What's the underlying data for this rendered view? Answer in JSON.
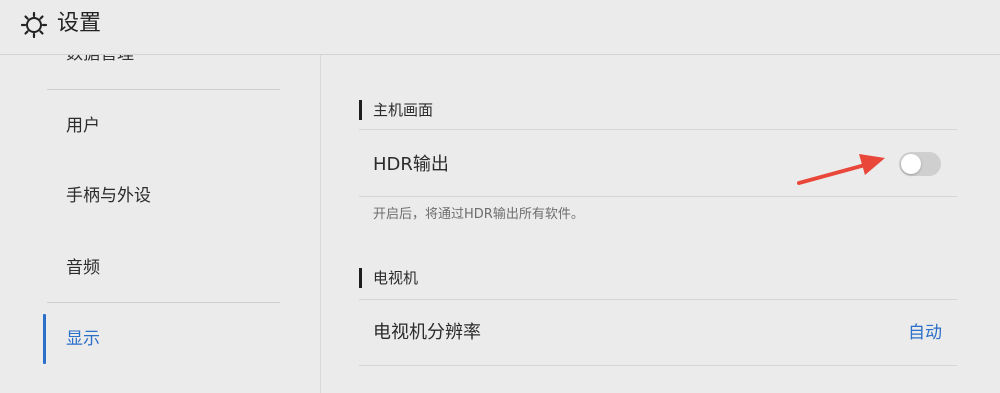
{
  "header": {
    "title": "设置",
    "icon": "gear-icon"
  },
  "sidebar": {
    "clipped_item": "数据管理",
    "items": [
      {
        "label": "用户"
      },
      {
        "label": "手柄与外设"
      },
      {
        "label": "音频"
      },
      {
        "label": "显示"
      }
    ],
    "active_item": "显示"
  },
  "main": {
    "section1": {
      "title": "主机画面",
      "hdr_label": "HDR输出",
      "hdr_enabled": false,
      "hdr_desc": "开启后，将通过HDR输出所有软件。"
    },
    "section2": {
      "title": "电视机",
      "resolution_label": "电视机分辨率",
      "resolution_value": "自动"
    }
  },
  "colors": {
    "accent": "#2a6fc9",
    "arrow": "#e8473a",
    "background": "#ebebeb"
  }
}
